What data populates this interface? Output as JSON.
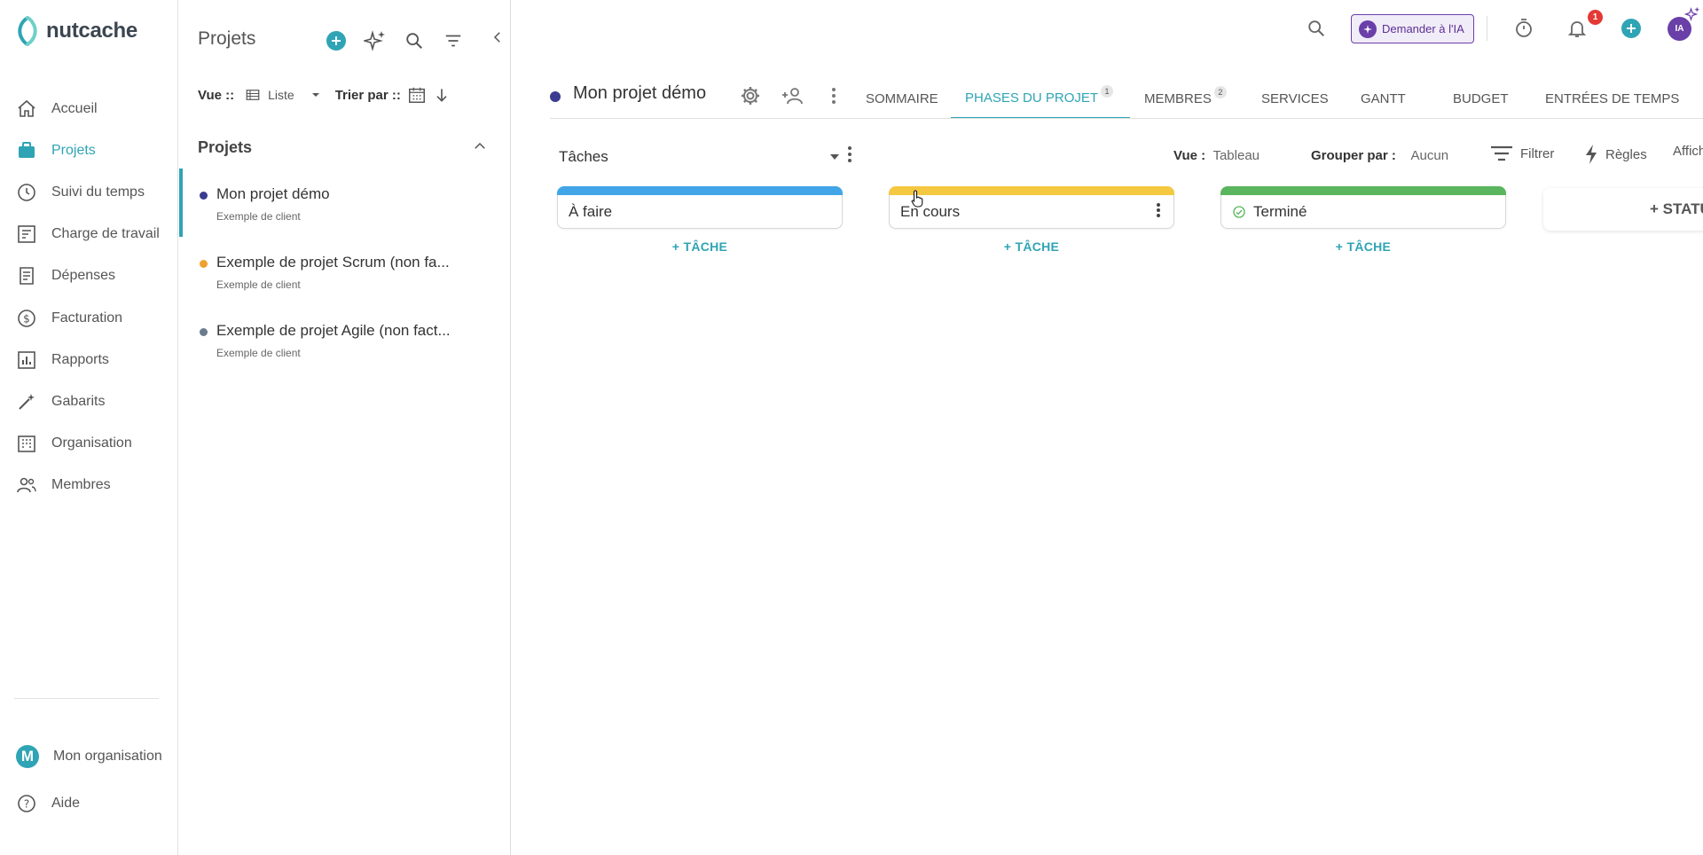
{
  "app": {
    "logo_text": "nutcache"
  },
  "nav": {
    "items": [
      {
        "label": "Accueil",
        "icon": "home-icon"
      },
      {
        "label": "Projets",
        "icon": "briefcase-icon",
        "active": true
      },
      {
        "label": "Suivi du temps",
        "icon": "clock-icon"
      },
      {
        "label": "Charge de travail",
        "icon": "workload-icon"
      },
      {
        "label": "Dépenses",
        "icon": "receipt-icon"
      },
      {
        "label": "Facturation",
        "icon": "dollar-icon"
      },
      {
        "label": "Rapports",
        "icon": "chart-icon"
      },
      {
        "label": "Gabarits",
        "icon": "magic-wand-icon"
      },
      {
        "label": "Organisation",
        "icon": "building-icon"
      },
      {
        "label": "Membres",
        "icon": "people-icon"
      }
    ],
    "org_label": "Mon organisation",
    "org_avatar": "M",
    "help_label": "Aide"
  },
  "panel": {
    "title": "Projets",
    "view_label": "Vue ::",
    "view_value": "Liste",
    "sort_label": "Trier par ::",
    "section_title": "Projets",
    "projects": [
      {
        "name": "Mon projet démo",
        "client": "Exemple de client",
        "color": "#3b3b8f",
        "active": true
      },
      {
        "name": "Exemple de projet Scrum (non fa...",
        "client": "Exemple de client",
        "color": "#f0a030"
      },
      {
        "name": "Exemple de projet Agile (non fact...",
        "client": "Exemple de client",
        "color": "#6b7b8c"
      }
    ]
  },
  "topbar": {
    "ai_button": "Demander à l'IA",
    "notif_count": "1",
    "user_initials": "IA"
  },
  "project": {
    "title": "Mon projet démo",
    "color": "#3b3b8f",
    "tabs": [
      {
        "label": "SOMMAIRE"
      },
      {
        "label": "PHASES DU PROJET",
        "badge": "1",
        "active": true
      },
      {
        "label": "MEMBRES",
        "badge": "2"
      },
      {
        "label": "SERVICES"
      },
      {
        "label": "GANTT"
      },
      {
        "label": "BUDGET"
      },
      {
        "label": "ENTRÉES DE TEMPS"
      }
    ]
  },
  "toolbar": {
    "tasks_label": "Tâches",
    "view_label": "Vue :",
    "view_value": "Tableau",
    "group_label": "Grouper par :",
    "group_value": "Aucun",
    "filter_label": "Filtrer",
    "rules_label": "Règles",
    "display_label": "Affich"
  },
  "board": {
    "columns": [
      {
        "title": "À faire",
        "color": "#42a5e8",
        "add_label": "+ TÂCHE"
      },
      {
        "title": "En cours",
        "color": "#f5c842",
        "add_label": "+ TÂCHE"
      },
      {
        "title": "Terminé",
        "color": "#5ab55e",
        "add_label": "+ TÂCHE",
        "done": true
      }
    ],
    "add_status_label": "+ STATUT"
  }
}
